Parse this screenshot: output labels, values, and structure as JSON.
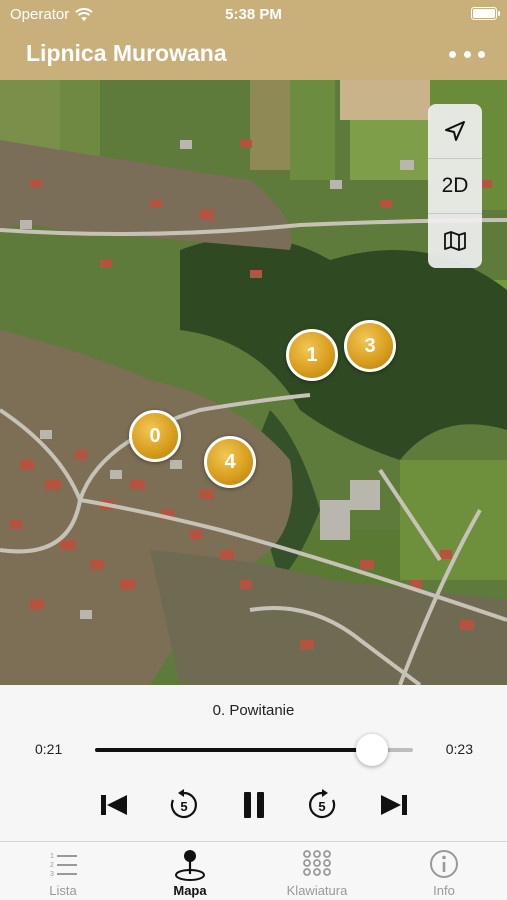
{
  "status_bar": {
    "carrier": "Operator",
    "time": "5:38 PM"
  },
  "nav": {
    "title": "Lipnica Murowana"
  },
  "map_controls": {
    "location_icon": "location-arrow-icon",
    "mode_label": "2D",
    "map_icon": "folded-map-icon"
  },
  "markers": [
    {
      "label": "1"
    },
    {
      "label": "3"
    },
    {
      "label": "0"
    },
    {
      "label": "4"
    }
  ],
  "player": {
    "track_title": "0. Powitanie",
    "elapsed": "0:21",
    "total": "0:23",
    "progress": 0.87,
    "controls": [
      "previous-icon",
      "rewind-5-icon",
      "pause-icon",
      "forward-5-icon",
      "next-icon"
    ],
    "skip_seconds": "5"
  },
  "tabs": [
    {
      "label": "Lista",
      "icon": "list-icon",
      "active": false
    },
    {
      "label": "Mapa",
      "icon": "map-pin-icon",
      "active": true
    },
    {
      "label": "Klawiatura",
      "icon": "keypad-icon",
      "active": false
    },
    {
      "label": "Info",
      "icon": "info-icon",
      "active": false
    }
  ],
  "colors": {
    "header": "#c9b07a",
    "marker": "#d99f1f",
    "active_tab": "#111111",
    "inactive_tab": "#999999"
  }
}
